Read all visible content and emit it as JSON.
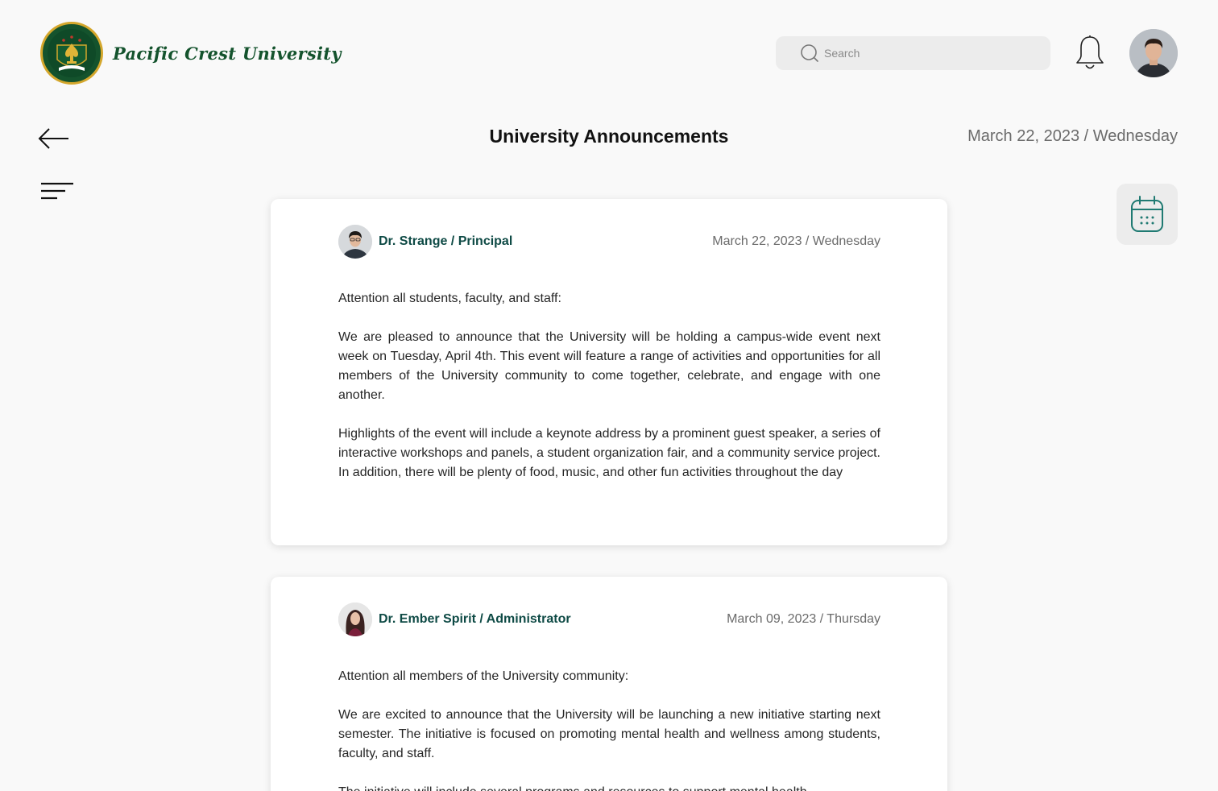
{
  "brand": {
    "name": "Pacific Crest University",
    "colors": {
      "primary": "#14532d",
      "accent": "#d4a72c",
      "teal": "#0e4a45"
    }
  },
  "search": {
    "placeholder": "Search",
    "icon": "search-icon"
  },
  "header": {
    "notifications_icon": "bell-icon",
    "profile_icon": "user-avatar"
  },
  "page": {
    "title": "University Announcements",
    "date": "March 22, 2023 / Wednesday",
    "back_icon": "arrow-left-icon",
    "menu_icon": "menu-icon",
    "calendar_icon": "calendar-icon"
  },
  "announcements": [
    {
      "author": "Dr. Strange / Principal",
      "date": "March 22, 2023 / Wednesday",
      "paragraphs": [
        "Attention all students, faculty, and staff:",
        "We are pleased to announce that the University will be holding a campus-wide event next week on Tuesday, April 4th. This event will feature a range of activities and opportunities for all members of the University community to come together, celebrate, and engage with one another.",
        "Highlights of the event will include a keynote address by a prominent guest speaker, a series of interactive workshops and panels, a student organization fair, and a community service project. In addition, there will be plenty of food, music, and other fun activities throughout the day"
      ]
    },
    {
      "author": "Dr. Ember Spirit / Administrator",
      "date": "March 09, 2023 / Thursday",
      "paragraphs": [
        "Attention all members of the University community:",
        "We are excited to announce that the University will be launching a new initiative starting next semester. The initiative is focused on promoting mental health and wellness among students, faculty, and staff.",
        "The initiative will include several programs and resources to support mental health"
      ]
    }
  ]
}
